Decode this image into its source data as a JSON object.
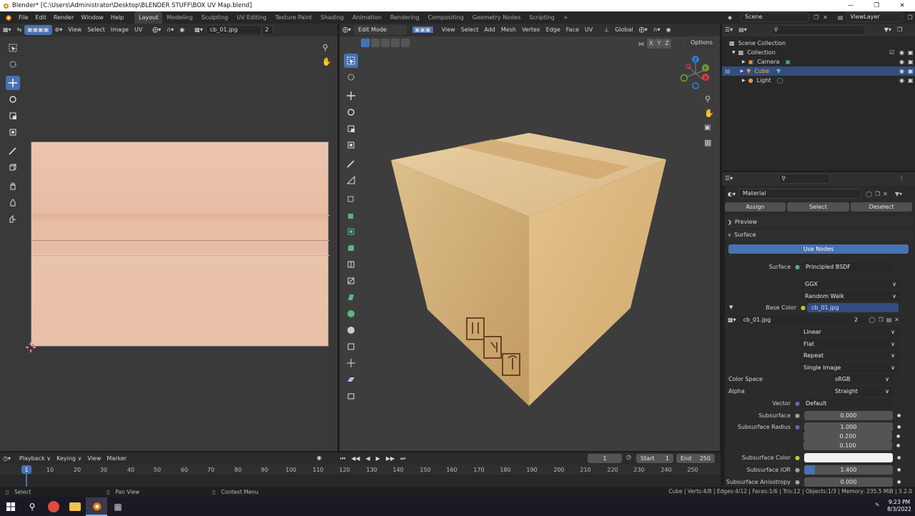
{
  "window": {
    "title": "Blender* [C:\\Users\\Administrator\\Desktop\\BLENDER STUFF\\BOX UV Map.blend]"
  },
  "menu": {
    "items": [
      "File",
      "Edit",
      "Render",
      "Window",
      "Help"
    ]
  },
  "workspaces": {
    "tabs": [
      "Layout",
      "Modeling",
      "Sculpting",
      "UV Editing",
      "Texture Paint",
      "Shading",
      "Animation",
      "Rendering",
      "Compositing",
      "Geometry Nodes",
      "Scripting"
    ],
    "active": "Layout"
  },
  "scene": {
    "label": "Scene",
    "view_layer": "ViewLayer"
  },
  "uv_editor": {
    "menus": [
      "View",
      "Select",
      "Image",
      "UV"
    ],
    "image_name": "cb_01.jpg",
    "users": "2"
  },
  "viewport": {
    "mode": "Edit Mode",
    "menus": [
      "View",
      "Select",
      "Add",
      "Mesh",
      "Vertex",
      "Edge",
      "Face",
      "UV"
    ],
    "orientation": "Global",
    "options": "Options",
    "axes": {
      "x": "X",
      "y": "Y",
      "z": "Z"
    }
  },
  "outliner": {
    "root": "Scene Collection",
    "collection": "Collection",
    "objects": [
      "Camera",
      "Cube",
      "Light"
    ]
  },
  "properties": {
    "material_name": "Material",
    "buttons": {
      "assign": "Assign",
      "select": "Select",
      "deselect": "Deselect"
    },
    "panels": {
      "preview": "Preview",
      "surface": "Surface"
    },
    "use_nodes": "Use Nodes",
    "surface_label": "Surface",
    "surface_value": "Principled BSDF",
    "distribution": "GGX",
    "subsurface_method": "Random Walk",
    "base_color_label": "Base Color",
    "base_color_value": "cb_01.jpg",
    "image_name": "cb_01.jpg",
    "image_users": "2",
    "interpolation": "Linear",
    "projection": "Flat",
    "extension": "Repeat",
    "source": "Single Image",
    "color_space_label": "Color Space",
    "color_space": "sRGB",
    "alpha_label": "Alpha",
    "alpha": "Straight",
    "vector_label": "Vector",
    "vector_value": "Default",
    "subsurface_label": "Subsurface",
    "subsurface": "0.000",
    "subsurface_radius_label": "Subsurface Radius",
    "subsurface_radius": [
      "1.000",
      "0.200",
      "0.100"
    ],
    "subsurface_color_label": "Subsurface Color",
    "subsurface_ior_label": "Subsurface IOR",
    "subsurface_ior": "1.400",
    "subsurface_anisotropy_label": "Subsurface Anisotropy",
    "subsurface_anisotropy": "0.000"
  },
  "timeline": {
    "menus": [
      "Playback",
      "Keying",
      "View",
      "Marker"
    ],
    "current_frame": "1",
    "start_label": "Start",
    "start": "1",
    "end_label": "End",
    "end": "250",
    "ruler": [
      "1",
      "10",
      "20",
      "30",
      "40",
      "50",
      "60",
      "70",
      "80",
      "90",
      "100",
      "110",
      "120",
      "130",
      "140",
      "150",
      "160",
      "170",
      "180",
      "190",
      "200",
      "210",
      "220",
      "230",
      "240",
      "250"
    ]
  },
  "statusbar": {
    "select": "Select",
    "pan": "Pan View",
    "context": "Context Menu",
    "stats": "Cube | Verts:4/8 | Edges:4/12 | Faces:1/6 | Tris:12 | Objects:1/3 | Memory: 235.5 MiB | 3.2.0"
  },
  "taskbar": {
    "time": "9:23 PM",
    "date": "8/3/2022"
  },
  "colors": {
    "accent": "#4772b3",
    "box": "#d8b57a",
    "texture": "#e9bfa6"
  }
}
